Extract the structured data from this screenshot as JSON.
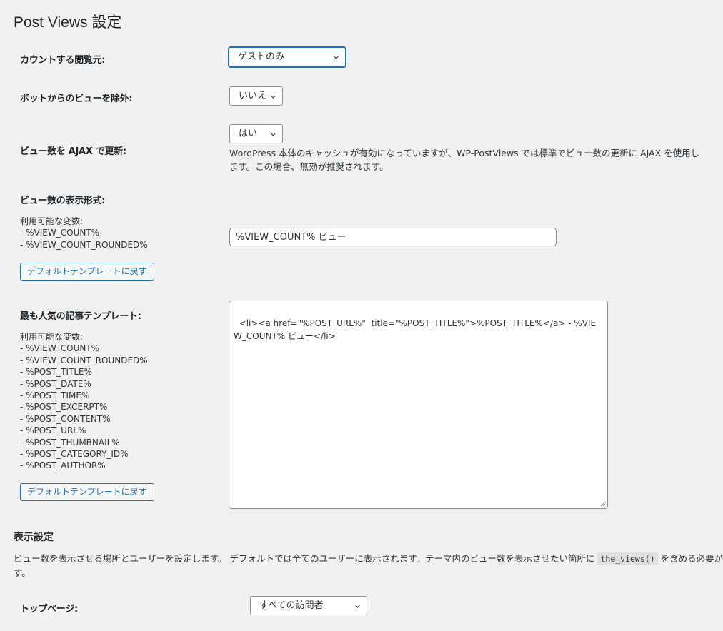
{
  "page_title": "Post Views 設定",
  "count_from": {
    "label": "カウントする閲覧元:",
    "value": "ゲストのみ"
  },
  "exclude_bots": {
    "label": "ボットからのビューを除外:",
    "value": "いいえ"
  },
  "ajax_update": {
    "label": "ビュー数を AJAX で更新:",
    "value": "はい",
    "description_line1": "WordPress 本体のキャッシュが有効になっていますが、WP-PostViews では標準でビュー数の更新に AJAX を使用し",
    "description_line2": "ます。この場合、無効が推奨されます。"
  },
  "view_format": {
    "label": "ビュー数の表示形式:",
    "vars_title": "利用可能な変数:",
    "vars": [
      "- %VIEW_COUNT%",
      "- %VIEW_COUNT_ROUNDED%"
    ],
    "input_value": "%VIEW_COUNT% ビュー",
    "reset_button": "デフォルトテンプレートに戻す"
  },
  "popular_template": {
    "label": "最も人気の記事テンプレート:",
    "vars_title": "利用可能な変数:",
    "vars": [
      "- %VIEW_COUNT%",
      "- %VIEW_COUNT_ROUNDED%",
      "- %POST_TITLE%",
      "- %POST_DATE%",
      "- %POST_TIME%",
      "- %POST_EXCERPT%",
      "- %POST_CONTENT%",
      "- %POST_URL%",
      "- %POST_THUMBNAIL%",
      "- %POST_CATEGORY_ID%",
      "- %POST_AUTHOR%"
    ],
    "textarea_value": "<li><a href=\"%POST_URL%\"  title=\"%POST_TITLE%\">%POST_TITLE%</a> - %VIEW_COUNT% ビュー</li>",
    "reset_button": "デフォルトテンプレートに戻す"
  },
  "display_settings": {
    "heading": "表示設定",
    "description_before": "ビュー数を表示させる場所とユーザーを設定します。 デフォルトでは全てのユーザーに表示されます。テーマ内のビュー数を表示させたい箇所に",
    "description_code": "the_views()",
    "description_after": "を含める必要がありま",
    "description_line2": "す。"
  },
  "top_page": {
    "label": "トップページ:",
    "value": "すべての訪問者"
  }
}
